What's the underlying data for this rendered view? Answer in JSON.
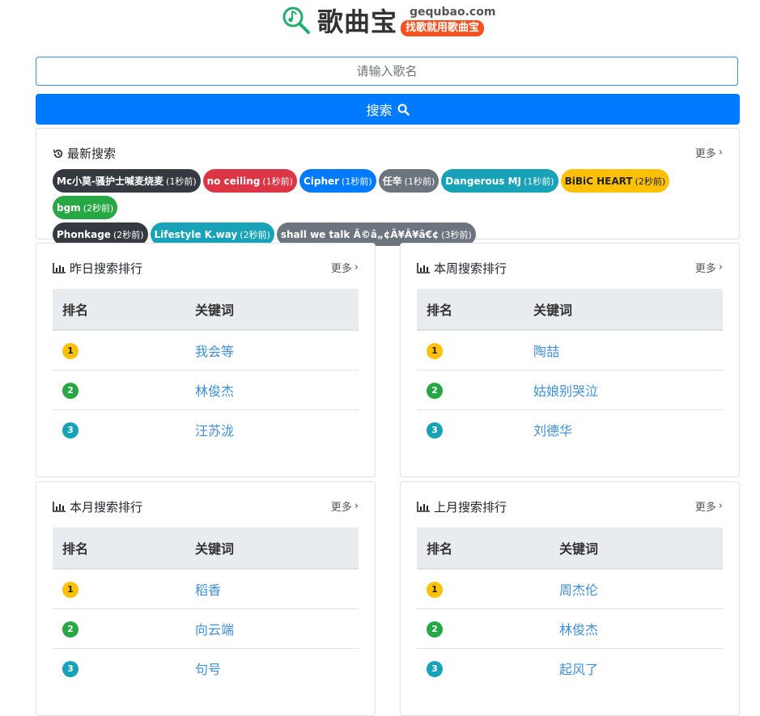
{
  "header": {
    "title": "歌曲宝",
    "domain": "gequbao.com",
    "slogan": "找歌就用歌曲宝"
  },
  "search": {
    "placeholder": "请输入歌名",
    "button_label": "搜索"
  },
  "latest": {
    "title": "最新搜索",
    "more_label": "更多",
    "items": [
      {
        "text": "Mc小莫-骚护士喊麦烧麦",
        "time": "(1秒前)",
        "color": "#343a40"
      },
      {
        "text": "no ceiling",
        "time": "(1秒前)",
        "color": "#dc3545"
      },
      {
        "text": "Cipher",
        "time": "(1秒前)",
        "color": "#007bff"
      },
      {
        "text": "任辛",
        "time": "(1秒前)",
        "color": "#6c757d"
      },
      {
        "text": "Dangerous MJ",
        "time": "(1秒前)",
        "color": "#17a2b8"
      },
      {
        "text": "BiBiC HEART",
        "time": "(2秒前)",
        "color": "#ffc107"
      },
      {
        "text": "bgm",
        "time": "(2秒前)",
        "color": "#28a745"
      },
      {
        "text": "Phonkage",
        "time": "(2秒前)",
        "color": "#343a40"
      },
      {
        "text": "Lifestyle K.way",
        "time": "(2秒前)",
        "color": "#17a2b8"
      },
      {
        "text": "shall we talk Ã©â„¢Ã¥Â¥â€¢",
        "time": "(3秒前)",
        "color": "#6c757d"
      }
    ]
  },
  "rankings": [
    {
      "title": "昨日搜索排行",
      "more_label": "更多",
      "col_rank": "排名",
      "col_keyword": "关键词",
      "rows": [
        {
          "rank": "1",
          "keyword": "我会等"
        },
        {
          "rank": "2",
          "keyword": "林俊杰"
        },
        {
          "rank": "3",
          "keyword": "汪苏泷"
        }
      ]
    },
    {
      "title": "本周搜索排行",
      "more_label": "更多",
      "col_rank": "排名",
      "col_keyword": "关键词",
      "rows": [
        {
          "rank": "1",
          "keyword": "陶喆"
        },
        {
          "rank": "2",
          "keyword": "姑娘别哭泣"
        },
        {
          "rank": "3",
          "keyword": "刘德华"
        }
      ]
    },
    {
      "title": "本月搜索排行",
      "more_label": "更多",
      "col_rank": "排名",
      "col_keyword": "关键词",
      "rows": [
        {
          "rank": "1",
          "keyword": "稻香"
        },
        {
          "rank": "2",
          "keyword": "向云端"
        },
        {
          "rank": "3",
          "keyword": "句号"
        }
      ]
    },
    {
      "title": "上月搜索排行",
      "more_label": "更多",
      "col_rank": "排名",
      "col_keyword": "关键词",
      "rows": [
        {
          "rank": "1",
          "keyword": "周杰伦"
        },
        {
          "rank": "2",
          "keyword": "林俊杰"
        },
        {
          "rank": "3",
          "keyword": "起风了"
        }
      ]
    }
  ]
}
